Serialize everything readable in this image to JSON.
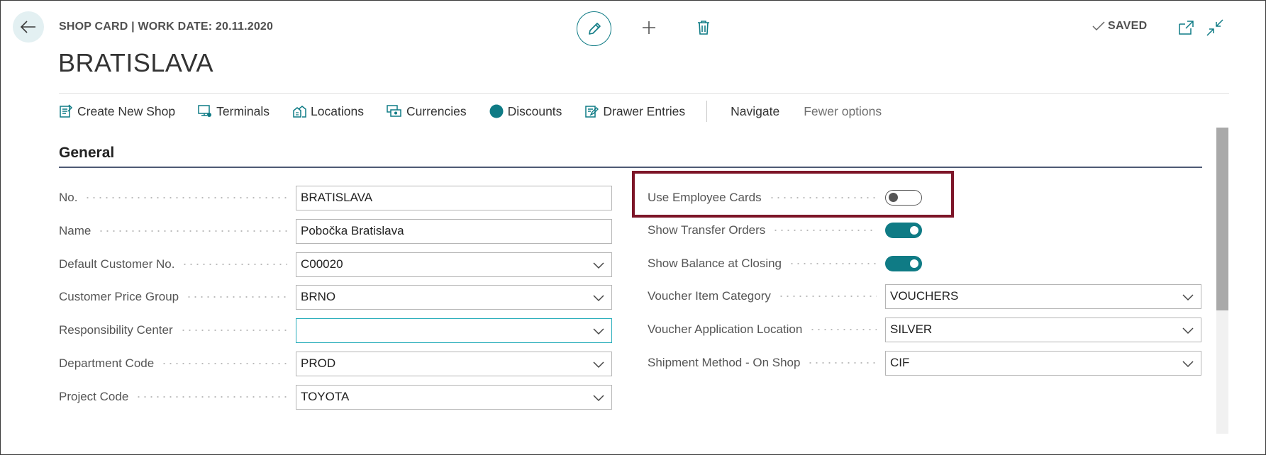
{
  "header": {
    "caption": "SHOP CARD | WORK DATE: 20.11.2020",
    "title": "BRATISLAVA",
    "saved_label": "SAVED"
  },
  "actions": [
    {
      "label": "Create New Shop",
      "icon": "create-shop-icon"
    },
    {
      "label": "Terminals",
      "icon": "terminal-icon"
    },
    {
      "label": "Locations",
      "icon": "locations-icon"
    },
    {
      "label": "Currencies",
      "icon": "currencies-icon"
    },
    {
      "label": "Discounts",
      "icon": "discount-icon"
    },
    {
      "label": "Drawer Entries",
      "icon": "drawer-entries-icon"
    }
  ],
  "nav": {
    "navigate": "Navigate",
    "fewer_options": "Fewer options"
  },
  "section": {
    "title": "General"
  },
  "left_fields": [
    {
      "label": "No.",
      "value": "BRATISLAVA",
      "type": "text"
    },
    {
      "label": "Name",
      "value": "Pobočka Bratislava",
      "type": "text"
    },
    {
      "label": "Default Customer No.",
      "value": "C00020",
      "type": "select"
    },
    {
      "label": "Customer Price Group",
      "value": "BRNO",
      "type": "select"
    },
    {
      "label": "Responsibility Center",
      "value": "",
      "type": "select",
      "focused": true
    },
    {
      "label": "Department Code",
      "value": "PROD",
      "type": "select"
    },
    {
      "label": "Project Code",
      "value": "TOYOTA",
      "type": "select"
    }
  ],
  "right_fields": [
    {
      "label": "Use Employee Cards",
      "type": "toggle",
      "on": false
    },
    {
      "label": "Show Transfer Orders",
      "type": "toggle",
      "on": true
    },
    {
      "label": "Show Balance at Closing",
      "type": "toggle",
      "on": true
    },
    {
      "label": "Voucher Item Category",
      "value": "VOUCHERS",
      "type": "select"
    },
    {
      "label": "Voucher Application Location",
      "value": "SILVER",
      "type": "select"
    },
    {
      "label": "Shipment Method - On Shop",
      "value": "CIF",
      "type": "select"
    }
  ],
  "colors": {
    "accent": "#0f7b85",
    "highlight": "#7d1528",
    "section_line": "#4e5a74"
  }
}
